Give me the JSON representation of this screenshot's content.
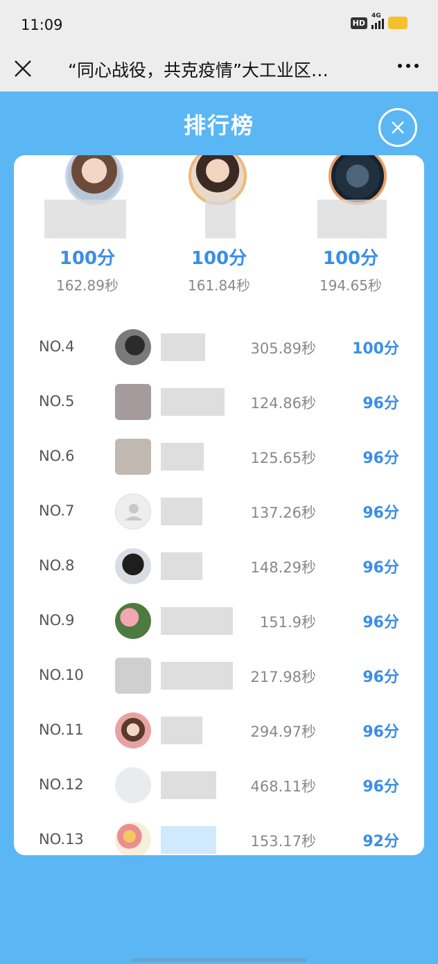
{
  "status_bar": {
    "time": "11:09",
    "hd": "HD",
    "network": "4G"
  },
  "title_bar": {
    "title": "“同心战役，共克疫情”大工业区…"
  },
  "header": {
    "title": "排行榜"
  },
  "podium": [
    {
      "score": "100分",
      "time": "162.89秒"
    },
    {
      "score": "100分",
      "time": "161.84秒"
    },
    {
      "score": "100分",
      "time": "194.65秒"
    }
  ],
  "ranks": [
    {
      "no": "NO.4",
      "time": "305.89秒",
      "score": "100分"
    },
    {
      "no": "NO.5",
      "time": "124.86秒",
      "score": "96分"
    },
    {
      "no": "NO.6",
      "time": "125.65秒",
      "score": "96分"
    },
    {
      "no": "NO.7",
      "time": "137.26秒",
      "score": "96分"
    },
    {
      "no": "NO.8",
      "time": "148.29秒",
      "score": "96分"
    },
    {
      "no": "NO.9",
      "time": "151.9秒",
      "score": "96分"
    },
    {
      "no": "NO.10",
      "time": "217.98秒",
      "score": "96分"
    },
    {
      "no": "NO.11",
      "time": "294.97秒",
      "score": "96分"
    },
    {
      "no": "NO.12",
      "time": "468.11秒",
      "score": "96分"
    },
    {
      "no": "NO.13",
      "time": "153.17秒",
      "score": "92分"
    }
  ],
  "colors": {
    "background": "#5bb6f4",
    "accent": "#3a8ee6",
    "card": "#ffffff"
  }
}
